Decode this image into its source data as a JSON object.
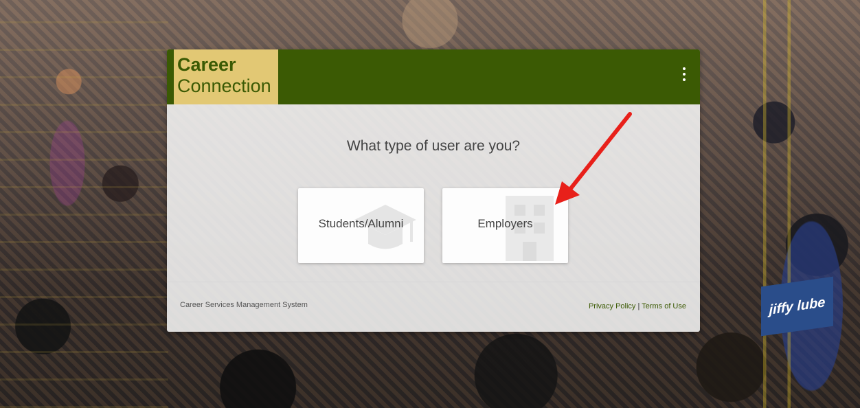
{
  "logo": {
    "line1": "Career",
    "line2": "Connection"
  },
  "header": {
    "menu_icon": "more-vert-icon"
  },
  "main": {
    "prompt": "What type of user are you?",
    "choices": [
      {
        "label": "Students/Alumni",
        "icon": "graduation-cap-icon"
      },
      {
        "label": "Employers",
        "icon": "building-icon"
      }
    ]
  },
  "footer": {
    "system_name": "Career Services Management System",
    "privacy_label": "Privacy Policy",
    "separator": "|",
    "terms_label": "Terms of Use"
  },
  "background": {
    "banner_text": "jiffy lube"
  },
  "colors": {
    "brand_green": "#3b5a04",
    "brand_gold": "#e2c874",
    "arrow_red": "#e8201a"
  }
}
